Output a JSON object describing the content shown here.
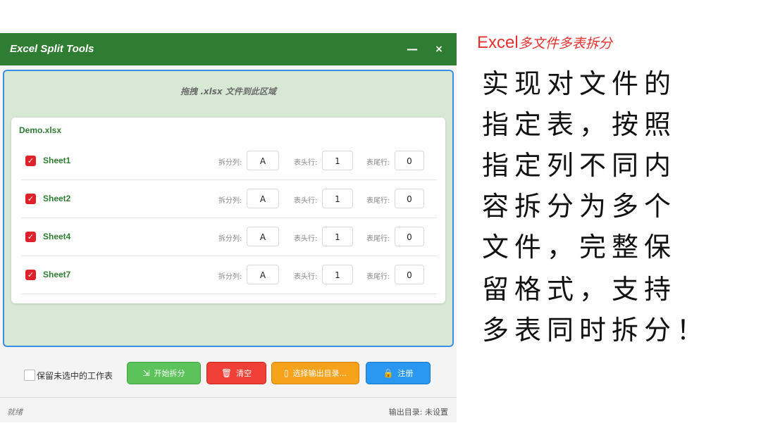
{
  "window": {
    "title": "Excel Split Tools",
    "minimize": "—",
    "close": "×"
  },
  "dropzone": {
    "hint": "拖拽 .xlsx 文件到此区域"
  },
  "file": {
    "name": "Demo.xlsx",
    "labels": {
      "split_col": "拆分列:",
      "header_rows": "表头行:",
      "footer_rows": "表尾行:"
    },
    "sheets": [
      {
        "name": "Sheet1",
        "checked": true,
        "split_col": "A",
        "header_rows": "1",
        "footer_rows": "0"
      },
      {
        "name": "Sheet2",
        "checked": true,
        "split_col": "A",
        "header_rows": "1",
        "footer_rows": "0"
      },
      {
        "name": "Sheet4",
        "checked": true,
        "split_col": "A",
        "header_rows": "1",
        "footer_rows": "0"
      },
      {
        "name": "Sheet7",
        "checked": true,
        "split_col": "A",
        "header_rows": "1",
        "footer_rows": "0"
      }
    ]
  },
  "controls": {
    "keep_unselected": "保留未选中的工作表",
    "start": "开始拆分",
    "clear": "清空",
    "choose_output": "选择输出目录...",
    "register": "注册"
  },
  "status": {
    "left": "就绪",
    "right": "输出目录: 未设置"
  },
  "promo": {
    "title_en": "Excel",
    "title_zh": "多文件多表拆分",
    "lines": [
      "  实现对文件的",
      "指定表，按照",
      "指定列不同内",
      "容拆分为多个",
      "文件，完整保",
      "留格式，支持",
      " 多表同时拆分！"
    ]
  },
  "colors": {
    "title_bar": "#2e7d32",
    "accent_green": "#2e7d32",
    "drop_border": "#3a8fe0",
    "promo_red": "#e53030"
  }
}
